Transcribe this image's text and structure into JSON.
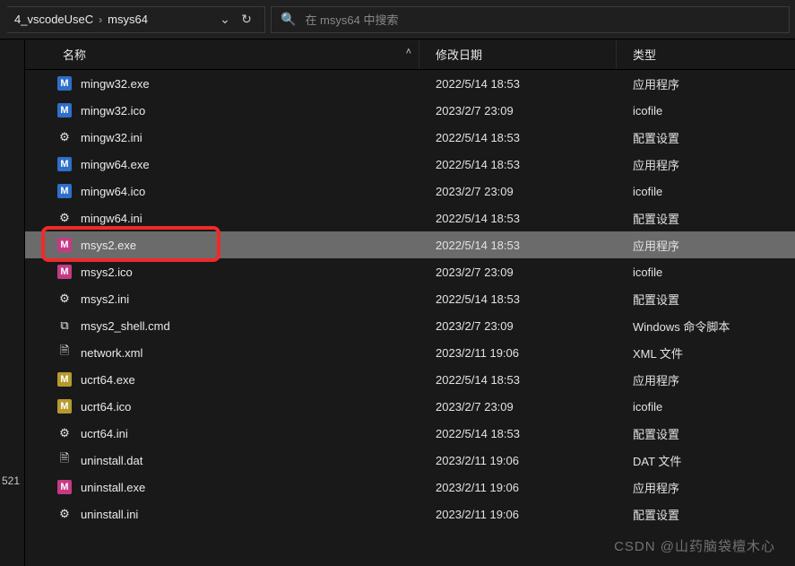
{
  "toolbar": {
    "breadcrumb": {
      "prev": "4_vscodeUseC",
      "current": "msys64"
    },
    "search_placeholder": "在 msys64 中搜索"
  },
  "columns": {
    "name": "名称",
    "date": "修改日期",
    "type": "类型"
  },
  "filetypes": {
    "exe": "应用程序",
    "ico": "icofile",
    "ini": "配置设置",
    "cmd": "Windows 命令脚本",
    "xml": "XML 文件",
    "dat": "DAT 文件"
  },
  "files": [
    {
      "icon": "m-blue",
      "name": "mingw32.exe",
      "date": "2022/5/14 18:53",
      "typekey": "exe"
    },
    {
      "icon": "m-blue",
      "name": "mingw32.ico",
      "date": "2023/2/7 23:09",
      "typekey": "ico"
    },
    {
      "icon": "ini",
      "name": "mingw32.ini",
      "date": "2022/5/14 18:53",
      "typekey": "ini"
    },
    {
      "icon": "m-blue",
      "name": "mingw64.exe",
      "date": "2022/5/14 18:53",
      "typekey": "exe"
    },
    {
      "icon": "m-blue",
      "name": "mingw64.ico",
      "date": "2023/2/7 23:09",
      "typekey": "ico"
    },
    {
      "icon": "ini",
      "name": "mingw64.ini",
      "date": "2022/5/14 18:53",
      "typekey": "ini"
    },
    {
      "icon": "m-pink",
      "name": "msys2.exe",
      "date": "2022/5/14 18:53",
      "typekey": "exe",
      "selected": true,
      "highlight": true
    },
    {
      "icon": "m-pink",
      "name": "msys2.ico",
      "date": "2023/2/7 23:09",
      "typekey": "ico"
    },
    {
      "icon": "ini",
      "name": "msys2.ini",
      "date": "2022/5/14 18:53",
      "typekey": "ini"
    },
    {
      "icon": "cmd",
      "name": "msys2_shell.cmd",
      "date": "2023/2/7 23:09",
      "typekey": "cmd"
    },
    {
      "icon": "file",
      "name": "network.xml",
      "date": "2023/2/11 19:06",
      "typekey": "xml"
    },
    {
      "icon": "m-yel",
      "name": "ucrt64.exe",
      "date": "2022/5/14 18:53",
      "typekey": "exe"
    },
    {
      "icon": "m-yel",
      "name": "ucrt64.ico",
      "date": "2023/2/7 23:09",
      "typekey": "ico"
    },
    {
      "icon": "ini",
      "name": "ucrt64.ini",
      "date": "2022/5/14 18:53",
      "typekey": "ini"
    },
    {
      "icon": "file",
      "name": "uninstall.dat",
      "date": "2023/2/11 19:06",
      "typekey": "dat"
    },
    {
      "icon": "m-pink",
      "name": "uninstall.exe",
      "date": "2023/2/11 19:06",
      "typekey": "exe"
    },
    {
      "icon": "ini",
      "name": "uninstall.ini",
      "date": "2023/2/11 19:06",
      "typekey": "ini"
    }
  ],
  "leftedge_text": "521",
  "watermark": "CSDN @山药脑袋檀木心"
}
